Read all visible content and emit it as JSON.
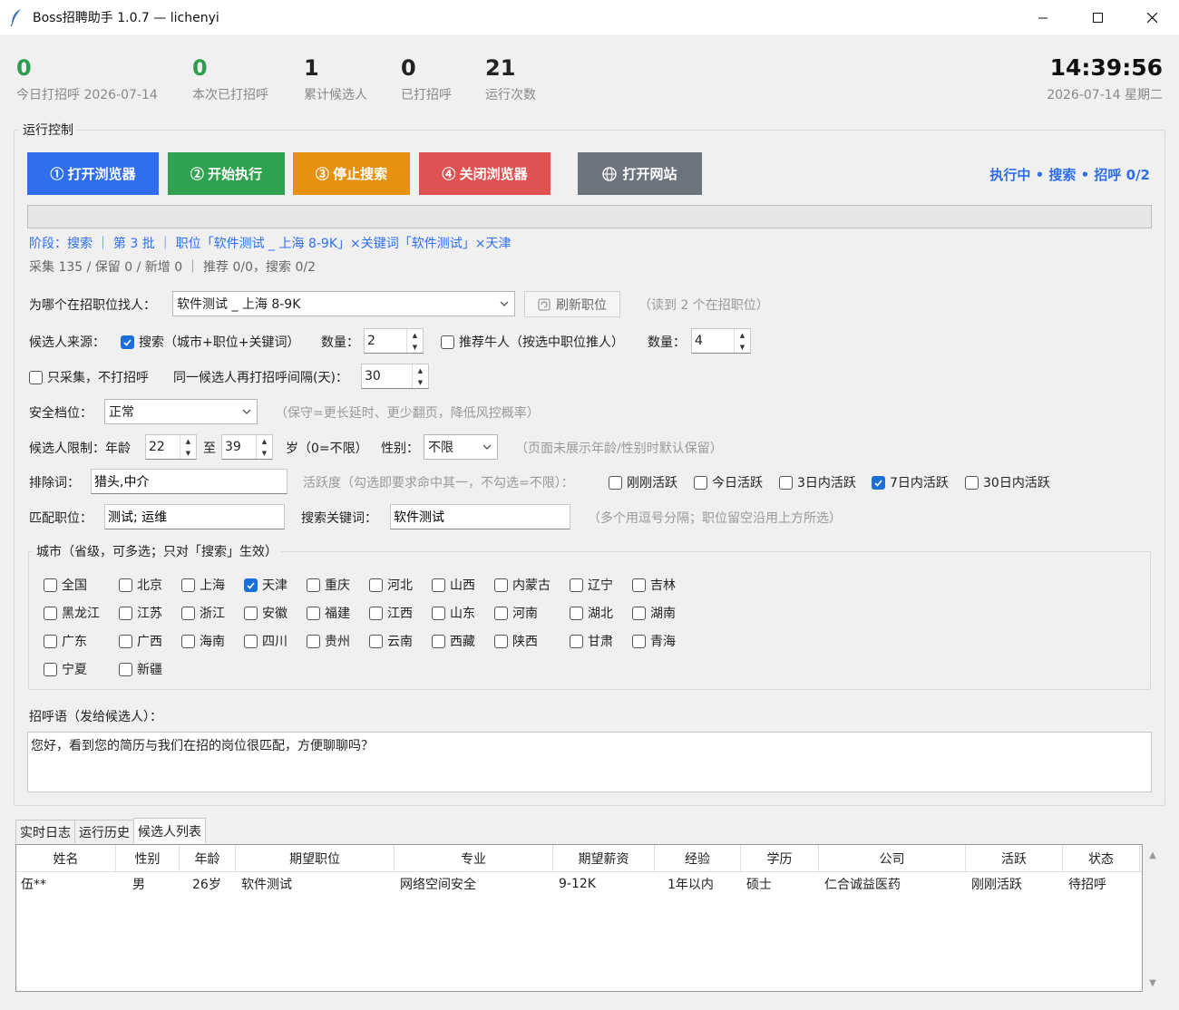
{
  "window": {
    "title": "Boss招聘助手 1.0.7 — lichenyi"
  },
  "stats": [
    {
      "value": "0",
      "label": "今日打招呼 2026-07-14"
    },
    {
      "value": "0",
      "label": "本次已打招呼"
    },
    {
      "value": "1",
      "label": "累计候选人"
    },
    {
      "value": "0",
      "label": "已打招呼"
    },
    {
      "value": "21",
      "label": "运行次数"
    }
  ],
  "clock": {
    "time": "14:39:56",
    "date": "2026-07-14 星期二"
  },
  "run_control": {
    "label": "运行控制",
    "buttons": {
      "open_browser": "① 打开浏览器",
      "start": "② 开始执行",
      "stop_search": "③ 停止搜索",
      "close_browser": "④ 关闭浏览器",
      "open_site": "打开网站"
    },
    "status": "执行中 • 搜索 • 招呼 0/2",
    "progress": 0,
    "phase": "阶段：搜索 ｜ 第 3 批 ｜ 职位「软件测试 _ 上海 8-9K」×关键词「软件测试」×天津",
    "collect": "采集 135 / 保留 0 / 新增 0 ｜ 推荐 0/0，搜索 0/2"
  },
  "job": {
    "label": "为哪个在招职位找人：",
    "value": "软件测试 _ 上海 8-9K",
    "refresh_label": "刷新职位",
    "hint": "（读到 2 个在招职位）"
  },
  "source": {
    "label": "候选人来源：",
    "search_label": "搜索（城市+职位+关键词）",
    "search_checked": true,
    "qty_label": "数量：",
    "search_qty": "2",
    "recommend_label": "推荐牛人（按选中职位推人）",
    "recommend_checked": false,
    "recommend_qty": "4"
  },
  "collect_only": {
    "label": "只采集，不打招呼",
    "checked": false,
    "interval_label": "同一候选人再打招呼间隔(天)：",
    "interval": "30"
  },
  "safety": {
    "label": "安全档位：",
    "value": "正常",
    "hint": "（保守=更长延时、更少翻页，降低风控概率）"
  },
  "limit": {
    "label": "候选人限制：年龄",
    "age_min": "22",
    "to": "至",
    "age_max": "39",
    "unit": "岁（0=不限）",
    "gender_label": "性别：",
    "gender": "不限",
    "hint": "（页面未展示年龄/性别时默认保留）"
  },
  "exclude": {
    "label": "排除词：",
    "value": "猎头,中介"
  },
  "activity": {
    "label": "活跃度（勾选即要求命中其一，不勾选=不限）：",
    "options": [
      {
        "label": "刚刚活跃",
        "checked": false
      },
      {
        "label": "今日活跃",
        "checked": false
      },
      {
        "label": "3日内活跃",
        "checked": false
      },
      {
        "label": "7日内活跃",
        "checked": true
      },
      {
        "label": "30日内活跃",
        "checked": false
      }
    ]
  },
  "match": {
    "label": "匹配职位：",
    "value": "测试; 运维",
    "keyword_label": "搜索关键词：",
    "keyword": "软件测试",
    "hint": "（多个用逗号分隔；职位留空沿用上方所选）"
  },
  "cities": {
    "label": "城市（省级，可多选；只对「搜索」生效）",
    "items": [
      {
        "label": "全国",
        "checked": false
      },
      {
        "label": "北京",
        "checked": false
      },
      {
        "label": "上海",
        "checked": false
      },
      {
        "label": "天津",
        "checked": true
      },
      {
        "label": "重庆",
        "checked": false
      },
      {
        "label": "河北",
        "checked": false
      },
      {
        "label": "山西",
        "checked": false
      },
      {
        "label": "内蒙古",
        "checked": false
      },
      {
        "label": "辽宁",
        "checked": false
      },
      {
        "label": "吉林",
        "checked": false
      },
      {
        "label": "黑龙江",
        "checked": false
      },
      {
        "label": "江苏",
        "checked": false
      },
      {
        "label": "浙江",
        "checked": false
      },
      {
        "label": "安徽",
        "checked": false
      },
      {
        "label": "福建",
        "checked": false
      },
      {
        "label": "江西",
        "checked": false
      },
      {
        "label": "山东",
        "checked": false
      },
      {
        "label": "河南",
        "checked": false
      },
      {
        "label": "湖北",
        "checked": false
      },
      {
        "label": "湖南",
        "checked": false
      },
      {
        "label": "广东",
        "checked": false
      },
      {
        "label": "广西",
        "checked": false
      },
      {
        "label": "海南",
        "checked": false
      },
      {
        "label": "四川",
        "checked": false
      },
      {
        "label": "贵州",
        "checked": false
      },
      {
        "label": "云南",
        "checked": false
      },
      {
        "label": "西藏",
        "checked": false
      },
      {
        "label": "陕西",
        "checked": false
      },
      {
        "label": "甘肃",
        "checked": false
      },
      {
        "label": "青海",
        "checked": false
      },
      {
        "label": "宁夏",
        "checked": false
      },
      {
        "label": "新疆",
        "checked": false
      }
    ]
  },
  "greeting": {
    "label": "招呼语（发给候选人）：",
    "text": "您好，看到您的简历与我们在招的岗位很匹配，方便聊聊吗？"
  },
  "tabs": [
    {
      "label": "实时日志",
      "active": false
    },
    {
      "label": "运行历史",
      "active": false
    },
    {
      "label": "候选人列表",
      "active": true
    }
  ],
  "table": {
    "columns": [
      "姓名",
      "性别",
      "年龄",
      "期望职位",
      "专业",
      "期望薪资",
      "经验",
      "学历",
      "公司",
      "活跃",
      "状态"
    ],
    "rows": [
      [
        "伍**",
        "男",
        "26岁",
        "软件测试",
        "网络空间安全",
        "9-12K",
        "1年以内",
        "硕士",
        "仁合诚益医药",
        "刚刚活跃",
        "待招呼"
      ]
    ]
  },
  "colors": {
    "accent": "#2f6fed",
    "green": "#2e9e4e",
    "orange": "#e8900f",
    "red": "#e05252",
    "gray": "#6c757d"
  }
}
